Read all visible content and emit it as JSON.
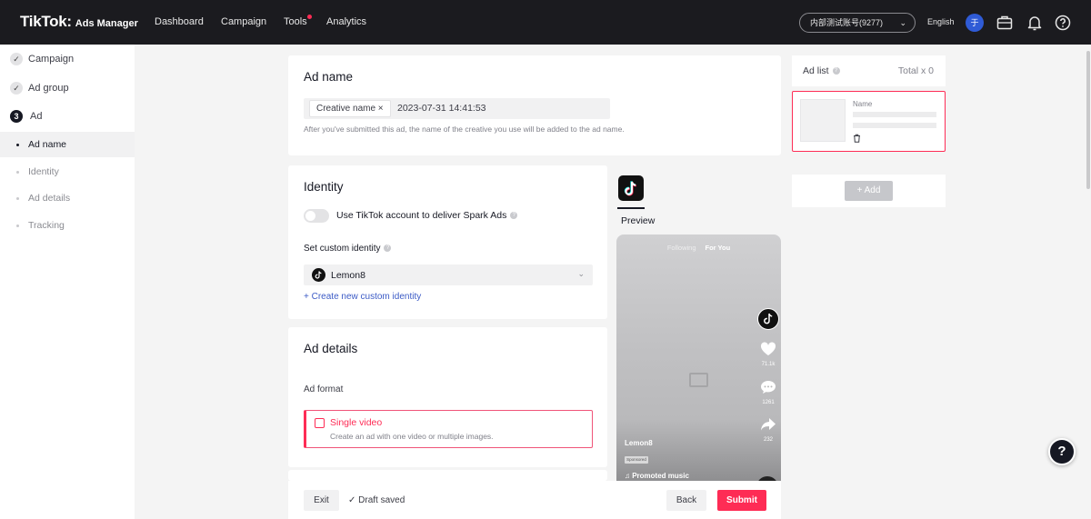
{
  "app": {
    "brand": "TikTok:",
    "brand_sub": "Ads Manager"
  },
  "topnav": {
    "items": [
      "Dashboard",
      "Campaign",
      "Tools",
      "Analytics"
    ],
    "account": "内部测试账号(9277)",
    "language": "English",
    "avatar_initial": "于",
    "icons": [
      "briefcase-icon",
      "bell-icon",
      "help-icon"
    ]
  },
  "sidebar": {
    "steps": [
      {
        "label": "Campaign",
        "status": "done"
      },
      {
        "label": "Ad group",
        "status": "done"
      },
      {
        "label": "Ad",
        "number": "3",
        "status": "current"
      }
    ],
    "substeps": [
      {
        "label": "Ad name",
        "active": true
      },
      {
        "label": "Identity",
        "active": false
      },
      {
        "label": "Ad details",
        "active": false
      },
      {
        "label": "Tracking",
        "active": false
      }
    ]
  },
  "ad_name": {
    "title": "Ad name",
    "chip": "Creative name ×",
    "value": "2023-07-31 14:41:53",
    "hint": "After you've submitted this ad, the name of the creative you use will be added to the ad name."
  },
  "identity": {
    "title": "Identity",
    "spark_label": "Use TikTok account to deliver Spark Ads",
    "spark_enabled": false,
    "custom_label": "Set custom identity",
    "selected_identity": "Lemon8",
    "create_link": "+ Create new custom identity"
  },
  "ad_details": {
    "title": "Ad details",
    "format_label": "Ad format",
    "format_option": "Single video",
    "format_desc": "Create an ad with one video or multiple images."
  },
  "preview": {
    "label": "Preview",
    "tab_following": "Following",
    "tab_foryou": "For You",
    "likes": "71.1k",
    "comments": "1261",
    "shares": "232",
    "username": "Lemon8",
    "sponsored": "Sponsored",
    "music": "♫ Promoted music"
  },
  "ad_list": {
    "title": "Ad list",
    "total": "Total x 0",
    "item_name_label": "Name",
    "add_label": "+ Add"
  },
  "footer": {
    "exit": "Exit",
    "draft": "✓ Draft saved",
    "back": "Back",
    "submit": "Submit"
  },
  "colors": {
    "accent": "#fe2c55",
    "topbar": "#1b1b1f",
    "link": "#3c5bc6"
  }
}
